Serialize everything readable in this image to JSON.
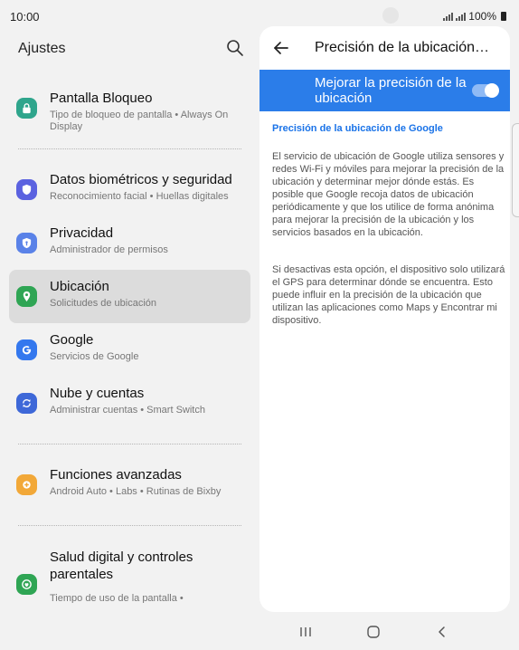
{
  "status_bar": {
    "time": "10:00",
    "battery": "100%"
  },
  "left": {
    "title": "Ajustes",
    "items": [
      {
        "title": "Pantalla Bloqueo",
        "subtitle": "Tipo de bloqueo de pantalla  •  Always On Display",
        "icon": "lock-icon",
        "color": "#2fa58c"
      },
      {
        "title": "Datos biométricos y seguridad",
        "subtitle": "Reconocimiento facial  •  Huellas digitales",
        "icon": "shield-icon",
        "color": "#5b62e0"
      },
      {
        "title": "Privacidad",
        "subtitle": "Administrador de permisos",
        "icon": "privacy-shield-icon",
        "color": "#5a82e8"
      },
      {
        "title": "Ubicación",
        "subtitle": "Solicitudes de ubicación",
        "icon": "location-pin-icon",
        "color": "#2fa554"
      },
      {
        "title": "Google",
        "subtitle": "Servicios de Google",
        "icon": "google-g-icon",
        "color": "#3478ee"
      },
      {
        "title": "Nube y cuentas",
        "subtitle": "Administrar cuentas  •  Smart Switch",
        "icon": "sync-icon",
        "color": "#3e68d8"
      },
      {
        "title": "Funciones avanzadas",
        "subtitle": "Android Auto  •  Labs  •  Rutinas de Bixby",
        "icon": "gear-plus-icon",
        "color": "#f2a838"
      },
      {
        "title": "Salud digital y controles parentales",
        "subtitle": "Tiempo de uso de la pantalla  •",
        "icon": "wellbeing-icon",
        "color": "#2fa554"
      }
    ]
  },
  "right": {
    "title": "Precisión de la ubicación…",
    "toggle_label": "Mejorar la precisión de la ubicación",
    "toggle_on": true,
    "section_heading": "Precisión de la ubicación de Google",
    "paragraph1": "El servicio de ubicación de Google utiliza sensores y redes Wi-Fi y móviles para mejorar la precisión de la ubicación y determinar mejor dónde estás. Es posible que Google recoja datos de ubicación periódicamente y que los utilice de forma anónima para mejorar la precisión de la ubicación y los servicios basados en la ubicación.",
    "paragraph2": "Si desactivas esta opción, el dispositivo solo utilizará el GPS para determinar dónde se encuentra. Esto puede influir en la precisión de la ubicación que utilizan las aplicaciones como Maps y Encontrar mi dispositivo."
  },
  "colors": {
    "accent": "#2b7de9",
    "heading_link": "#1a73e8",
    "selected_row": "#dcdcdc"
  }
}
